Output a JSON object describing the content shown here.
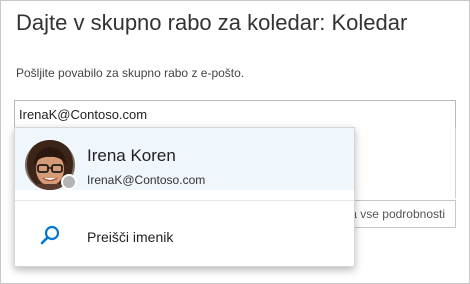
{
  "dialog": {
    "title": "Dajte v skupno rabo za koledar: Koledar",
    "instruction": "Pošljite povabilo za skupno rabo z e-pošto.",
    "email_value": "IrenaK@Contoso.com",
    "permission_partial_text": "da vse podrobnosti"
  },
  "suggestions": {
    "contact": {
      "name": "Irena Koren",
      "email": "IrenaK@Contoso.com",
      "presence": "offline",
      "presence_color": "#b4b4b4",
      "icon": "avatar-photo"
    },
    "search_directory_label": "Preišči imenik",
    "search_icon": "search-icon"
  },
  "colors": {
    "highlight": "#eff6fc",
    "accent": "#0078d4",
    "text": "#333333"
  }
}
